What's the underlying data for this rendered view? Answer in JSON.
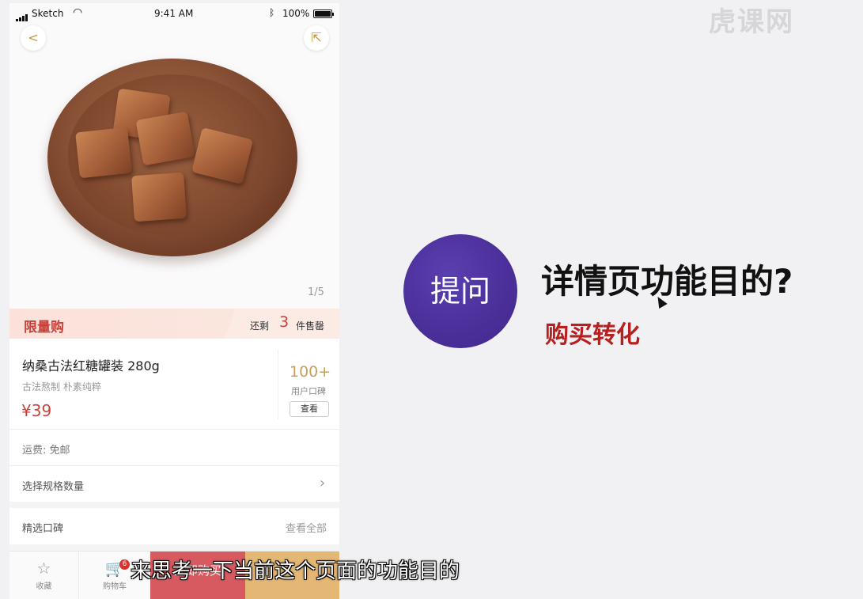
{
  "status_bar": {
    "carrier": "Sketch",
    "time": "9:41 AM",
    "battery": "100%"
  },
  "product": {
    "image_pager": "1/5",
    "flash_sale": {
      "title": "限量购",
      "remaining_prefix": "还剩",
      "remaining_count": "3",
      "remaining_suffix": "件售罄"
    },
    "name": "纳桑古法红糖罐装 280g",
    "tagline": "古法熬制 朴素纯粹",
    "price": "¥39",
    "reviews_summary": {
      "count": "100+",
      "label": "用户口碑",
      "view_button": "查看"
    },
    "shipping": "运费: 免邮",
    "spec_selector": "选择规格数量",
    "reviews_section": {
      "title": "精选口碑",
      "view_all": "查看全部"
    }
  },
  "tab_bar": {
    "favorite": "收藏",
    "cart": "购物车",
    "cart_badge": "6",
    "buy_now": "立即购买"
  },
  "icons": {
    "back": "chevron-left-icon",
    "share": "share-icon",
    "favorite": "star-icon",
    "cart": "cart-icon",
    "chevron": "chevron-right-icon"
  },
  "colors": {
    "accent_red": "#c9423a",
    "buy_button": "#d75a61",
    "cart_button": "#e5b774",
    "ask_circle": "#4a2f99",
    "answer_text": "#b81f1f"
  },
  "slide": {
    "watermark": "虎课网",
    "ask_label": "提问",
    "question": "详情页功能目的?",
    "answer": "购买转化"
  },
  "subtitle": "来思考一下当前这个页面的功能目的"
}
